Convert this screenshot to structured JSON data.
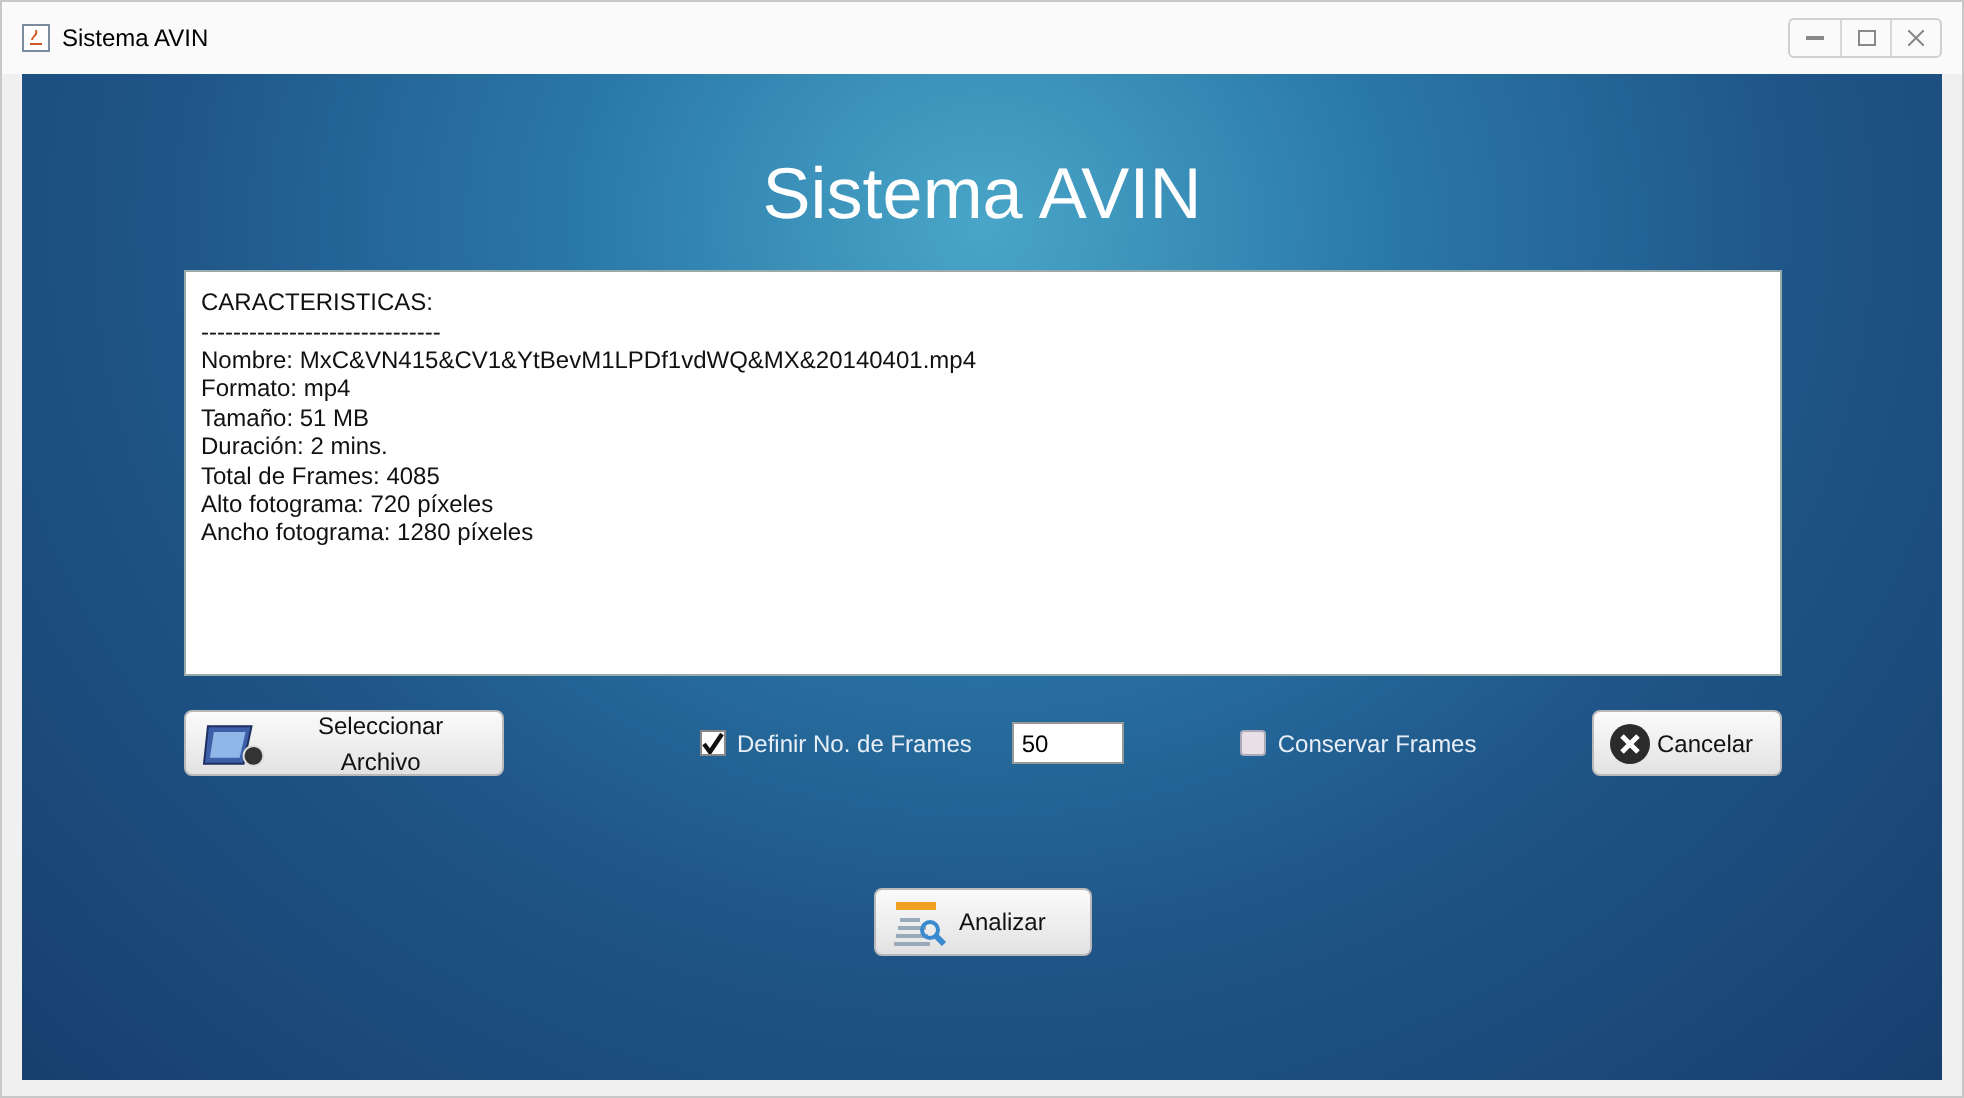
{
  "window": {
    "title": "Sistema AVIN"
  },
  "heading": "Sistema AVIN",
  "details": [
    "CARACTERISTICAS:",
    "------------------------------",
    "Nombre: MxC&VN415&CV1&YtBevM1LPDf1vdWQ&MX&20140401.mp4",
    "Formato: mp4",
    "Tamaño: 51 MB",
    "Duración: 2 mins.",
    "Total de Frames: 4085",
    "Alto fotograma: 720 píxeles",
    "Ancho fotograma: 1280 píxeles"
  ],
  "select_button": {
    "label": "Seleccionar Archivo"
  },
  "frames_option": {
    "label": "Definir No. de Frames",
    "checked": true,
    "value": "50"
  },
  "keep_option": {
    "label": "Conservar Frames",
    "checked": false
  },
  "cancel_button": {
    "label": "Cancelar"
  },
  "analyze_button": {
    "label": "Analizar"
  }
}
